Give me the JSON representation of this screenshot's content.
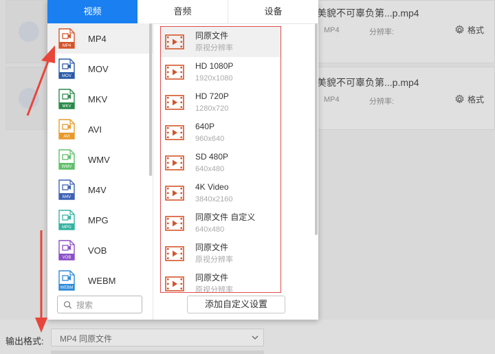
{
  "files": [
    {
      "name": "美貌不可辜负第...p.mp4",
      "format": "MP4",
      "resolution_label": "分辨率:",
      "format_button": "格式",
      "gear_icon": "gear-icon"
    },
    {
      "name": "美貌不可辜负第...p.mp4",
      "format": "MP4",
      "resolution_label": "分辨率:",
      "format_button": "格式",
      "gear_icon": "gear-icon"
    }
  ],
  "popup": {
    "tabs": [
      {
        "label": "视频",
        "active": true
      },
      {
        "label": "音频",
        "active": false
      },
      {
        "label": "设备",
        "active": false
      }
    ],
    "formats": [
      {
        "name": "MP4",
        "color": "#d4542b",
        "selected": true
      },
      {
        "name": "MOV",
        "color": "#2b5aa8",
        "selected": false
      },
      {
        "name": "MKV",
        "color": "#2a8a4a",
        "selected": false
      },
      {
        "name": "AVI",
        "color": "#e89a2c",
        "selected": false
      },
      {
        "name": "WMV",
        "color": "#5fbf6a",
        "selected": false
      },
      {
        "name": "M4V",
        "color": "#3d62b5",
        "selected": false
      },
      {
        "name": "MPG",
        "color": "#33b3a0",
        "selected": false
      },
      {
        "name": "VOB",
        "color": "#8b4fc8",
        "selected": false
      },
      {
        "name": "WEBM",
        "color": "#2f8ad8",
        "selected": false
      }
    ],
    "search_placeholder": "搜索",
    "presets": [
      {
        "title": "同原文件",
        "subtitle": "原视分辨率",
        "selected": true
      },
      {
        "title": "HD 1080P",
        "subtitle": "1920x1080",
        "selected": false
      },
      {
        "title": "HD 720P",
        "subtitle": "1280x720",
        "selected": false
      },
      {
        "title": "640P",
        "subtitle": "960x640",
        "selected": false
      },
      {
        "title": "SD 480P",
        "subtitle": "640x480",
        "selected": false
      },
      {
        "title": "4K Video",
        "subtitle": "3840x2160",
        "selected": false
      },
      {
        "title": "同原文件 自定义",
        "subtitle": "640x480",
        "selected": false
      },
      {
        "title": "同原文件",
        "subtitle": "原视分辨率",
        "selected": false
      },
      {
        "title": "同原文件",
        "subtitle": "原视分辨率",
        "selected": false
      }
    ],
    "add_custom_label": "添加自定义设置",
    "preset_icon_color": "#d4542b"
  },
  "bottom": {
    "output_label": "输出格式:",
    "output_value": "MP4  同原文件"
  },
  "colors": {
    "accent": "#1a7ff0",
    "highlight_border": "#e04c4c",
    "arrow": "#e8463a"
  }
}
